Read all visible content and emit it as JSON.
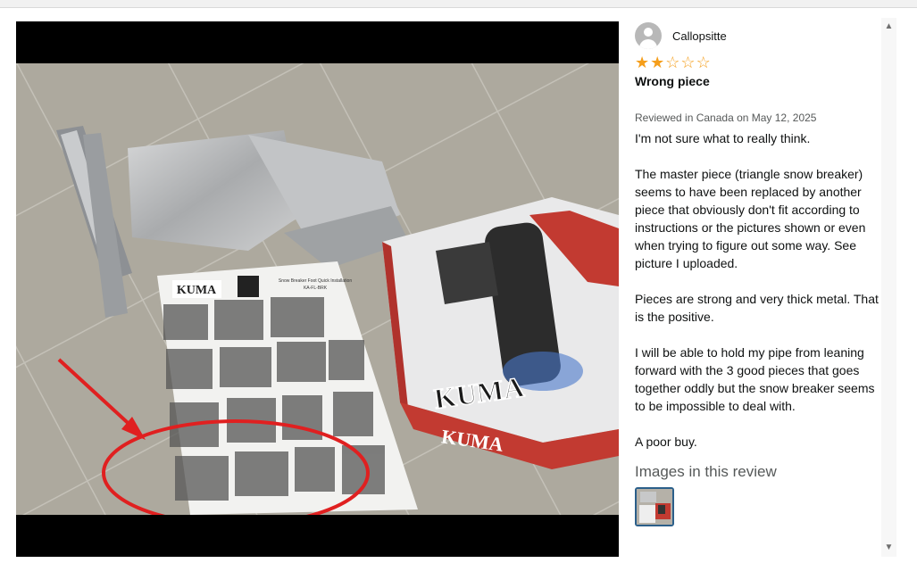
{
  "review": {
    "username": "Callopsitte",
    "rating": "2 out of 5 stars",
    "title": "Wrong piece",
    "date": "Reviewed in Canada on May 12, 2025",
    "paragraphs": [
      "I'm not sure what to really think.",
      "The master piece (triangle snow breaker) seems to have been replaced by another piece that obviously don't fit according to instructions or the pictures shown or even when trying to figure out some way. See picture I uploaded.",
      "Pieces are strong and very thick metal. That is the positive.",
      "I will be able to hold my pipe from leaning forward with the 3 good pieces that goes together oddly but the snow breaker seems to be impossible to deal with.",
      "A poor buy."
    ],
    "images_heading": "Images in this review"
  },
  "photo": {
    "brand_text": "KUMA",
    "brand_text_box": "KUMA",
    "sheet_header": "Snow Breaker Foot Quick Installation",
    "sheet_code": "KA-FL-BRK"
  },
  "icons": {
    "avatar": "user-avatar-icon",
    "up": "scroll-up-icon",
    "down": "scroll-down-icon"
  },
  "colors": {
    "star": "#f59e1b",
    "thumb_border": "#2b5f8a",
    "annotation": "#e02020"
  }
}
